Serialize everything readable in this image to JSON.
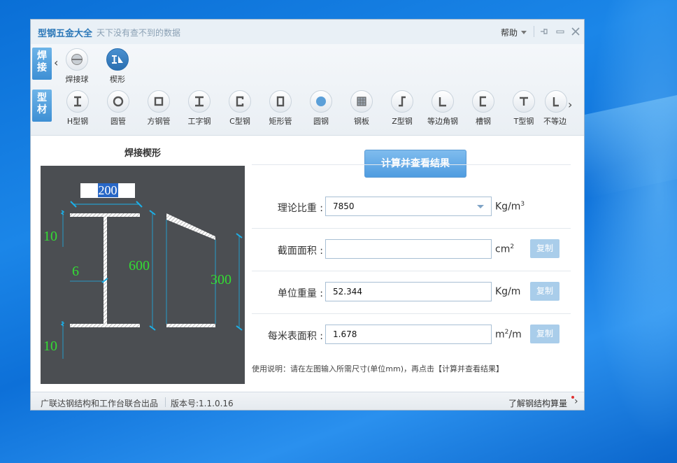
{
  "window": {
    "title": "型钢五金大全",
    "subtitle": "天下没有查不到的数据",
    "help_label": "帮助",
    "controls": [
      "pin-icon",
      "minimize-icon",
      "close-icon"
    ]
  },
  "categories": {
    "weld": {
      "chars": [
        "焊",
        "接"
      ]
    },
    "steel": {
      "chars": [
        "型",
        "材"
      ]
    }
  },
  "weld_tools": [
    {
      "label": "焊接球",
      "icon": "weld-ball-icon",
      "selected": false
    },
    {
      "label": "楔形",
      "icon": "wedge-icon",
      "selected": true
    }
  ],
  "steel_tools": [
    {
      "label": "H型钢",
      "icon": "h-beam-icon"
    },
    {
      "label": "圆管",
      "icon": "round-pipe-icon"
    },
    {
      "label": "方钢管",
      "icon": "square-pipe-icon"
    },
    {
      "label": "工字钢",
      "icon": "i-beam-icon"
    },
    {
      "label": "C型钢",
      "icon": "c-channel-icon"
    },
    {
      "label": "矩形管",
      "icon": "rect-pipe-icon"
    },
    {
      "label": "圆钢",
      "icon": "round-bar-icon"
    },
    {
      "label": "钢板",
      "icon": "steel-plate-icon"
    },
    {
      "label": "Z型钢",
      "icon": "z-section-icon"
    },
    {
      "label": "等边角钢",
      "icon": "equal-angle-icon"
    },
    {
      "label": "槽钢",
      "icon": "channel-icon"
    },
    {
      "label": "T型钢",
      "icon": "t-section-icon"
    },
    {
      "label": "不等边",
      "icon": "unequal-angle-icon"
    }
  ],
  "left_panel": {
    "title": "焊接楔形",
    "dims": {
      "top_width": "200",
      "top_flange": "10",
      "web": "6",
      "height": "600",
      "end_height": "300",
      "bottom_flange": "10"
    }
  },
  "calc_button": "计算并查看结果",
  "form": {
    "density": {
      "label": "理论比重 :",
      "value": "7850",
      "unit": "Kg/m",
      "unit_sup": "3"
    },
    "area": {
      "label": "截面面积 :",
      "value": "",
      "unit": "cm",
      "unit_sup": "2",
      "copy": "复制"
    },
    "unit_weight": {
      "label": "单位重量 :",
      "value": "52.344",
      "unit": "Kg/m",
      "copy": "复制"
    },
    "surface_area": {
      "label": "每米表面积 :",
      "value": "1.678",
      "unit_pre": "m",
      "unit_sup": "2",
      "unit_post": "/m",
      "copy": "复制"
    }
  },
  "instructions": "使用说明：请在左图输入所需尺寸(单位mm)，再点击【计算并查看结果】",
  "status": {
    "credit": "广联达钢结构和工作台联合出品",
    "version": "版本号:1.1.0.16",
    "learn_more": "了解钢结构算量"
  },
  "colors": {
    "accent": "#4a9be0",
    "dimension_text": "#33dd33",
    "dimension_line": "#1cb0e8",
    "drawing_bg": "#4b4e52"
  }
}
